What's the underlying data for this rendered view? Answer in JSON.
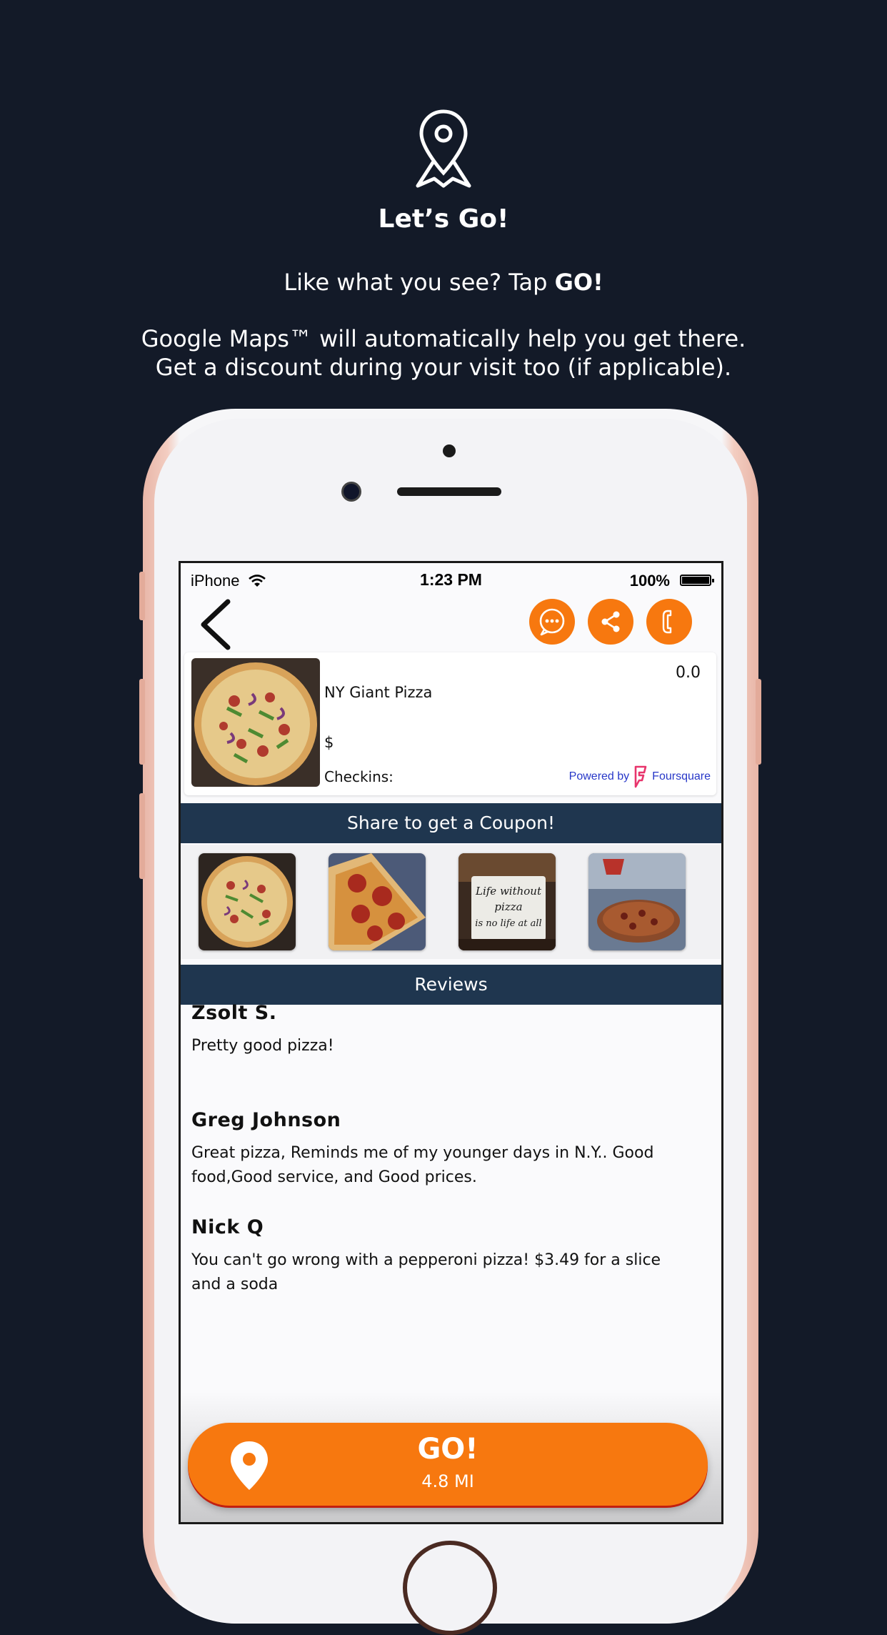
{
  "hero": {
    "title": "Let’s Go!",
    "line1_prefix": "Like what you see? Tap ",
    "line1_bold": "GO!",
    "line2": "Google Maps™ will automatically help you get there.",
    "line3": "Get a discount during your visit too (if applicable)."
  },
  "status_bar": {
    "carrier": "iPhone",
    "time": "1:23 PM",
    "battery": "100%",
    "battery_level": 1.0
  },
  "nav": {
    "back_icon": "chevron-left-icon",
    "actions": [
      "chat-icon",
      "share-icon",
      "phone-icon"
    ],
    "accent_color": "#f7780f"
  },
  "venue": {
    "name": "NY Giant Pizza",
    "rating": "0.0",
    "price": "$",
    "checkins_label": "Checkins:",
    "powered_by": "Powered by",
    "provider": "Foursquare"
  },
  "coupon_bar": {
    "label": "Share to get a Coupon!"
  },
  "photos": [
    {
      "subject": "whole pizza"
    },
    {
      "subject": "pepperoni slice"
    },
    {
      "subject": "Life without pizza is no life at all sign"
    },
    {
      "subject": "pizza in oven"
    }
  ],
  "photo_sign_text": "Life without pizza is no life at all",
  "reviews_bar": {
    "label": "Reviews"
  },
  "reviews": [
    {
      "author": "Zsolt S.",
      "text": "Pretty good pizza!"
    },
    {
      "author": "Greg Johnson",
      "text": "Great pizza, Reminds me of my younger days in N.Y.. Good food,Good service, and Good prices."
    },
    {
      "author": "Nick Q",
      "text": "You can't go wrong with a pepperoni pizza! $3.49 for a slice and a soda"
    }
  ],
  "go_button": {
    "label": "GO!",
    "distance": "4.8 MI"
  },
  "colors": {
    "background": "#131a28",
    "section_bar": "#1f364f",
    "accent": "#f7780f"
  }
}
